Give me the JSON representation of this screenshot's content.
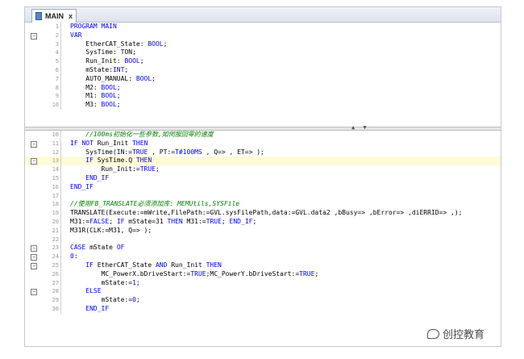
{
  "tab": {
    "title": "MAIN",
    "close": "x"
  },
  "top_pane": {
    "lines": [
      {
        "n": "1",
        "fold": "",
        "segs": [
          [
            "kw",
            "PROGRAM MAIN"
          ]
        ]
      },
      {
        "n": "2",
        "fold": "−",
        "segs": [
          [
            "kw",
            "VAR"
          ]
        ]
      },
      {
        "n": "3",
        "fold": "",
        "segs": [
          [
            "",
            "    EtherCAT_State: "
          ],
          [
            "kw",
            "BOOL"
          ],
          [
            "",
            ";"
          ]
        ]
      },
      {
        "n": "4",
        "fold": "",
        "segs": [
          [
            "",
            "    SysTime: TON;"
          ]
        ]
      },
      {
        "n": "5",
        "fold": "",
        "segs": [
          [
            "",
            "    Run_Init: "
          ],
          [
            "kw",
            "BOOL"
          ],
          [
            "",
            ";"
          ]
        ]
      },
      {
        "n": "6",
        "fold": "",
        "segs": [
          [
            "",
            "    mState:"
          ],
          [
            "kw",
            "INT"
          ],
          [
            "",
            ";"
          ]
        ]
      },
      {
        "n": "7",
        "fold": "",
        "segs": [
          [
            "",
            "    AUTO_MANUAL: "
          ],
          [
            "kw",
            "BOOL"
          ],
          [
            "",
            ";"
          ]
        ]
      },
      {
        "n": "8",
        "fold": "",
        "segs": [
          [
            "",
            "    M2: "
          ],
          [
            "kw",
            "BOOL"
          ],
          [
            "",
            ";"
          ]
        ]
      },
      {
        "n": "9",
        "fold": "",
        "segs": [
          [
            "",
            "    M1: "
          ],
          [
            "kw",
            "BOOL"
          ],
          [
            "",
            ";"
          ]
        ]
      },
      {
        "n": "10",
        "fold": "",
        "segs": [
          [
            "",
            "    M3: "
          ],
          [
            "kw",
            "BOOL"
          ],
          [
            "",
            ";"
          ]
        ]
      }
    ]
  },
  "bottom_pane": {
    "lines": [
      {
        "n": "10",
        "fold": "",
        "hl": false,
        "segs": [
          [
            "cm",
            "    //100ms初始化一些参数,如伺服回零的速度"
          ]
        ]
      },
      {
        "n": "11",
        "fold": "−",
        "hl": false,
        "segs": [
          [
            "kw",
            "IF NOT "
          ],
          [
            "",
            "Run_Init "
          ],
          [
            "kw",
            "THEN"
          ]
        ]
      },
      {
        "n": "12",
        "fold": "",
        "hl": false,
        "segs": [
          [
            "",
            "    SysTime(IN:="
          ],
          [
            "kw",
            "TRUE"
          ],
          [
            "",
            " , PT:="
          ],
          [
            "kw",
            "T#100MS"
          ],
          [
            "",
            " , Q=> , ET=> );"
          ]
        ]
      },
      {
        "n": "13",
        "fold": "−",
        "hl": true,
        "segs": [
          [
            "kw",
            "    IF "
          ],
          [
            "",
            "SysTime.Q "
          ],
          [
            "kw",
            "THEN"
          ]
        ]
      },
      {
        "n": "14",
        "fold": "",
        "hl": false,
        "segs": [
          [
            "",
            "        Run_Init:="
          ],
          [
            "kw",
            "TRUE"
          ],
          [
            "",
            ";"
          ]
        ]
      },
      {
        "n": "15",
        "fold": "",
        "hl": false,
        "segs": [
          [
            "kw",
            "    END_IF"
          ]
        ]
      },
      {
        "n": "16",
        "fold": "",
        "hl": false,
        "segs": [
          [
            "kw",
            "END_IF"
          ]
        ]
      },
      {
        "n": "17",
        "fold": "",
        "hl": false,
        "segs": [
          [
            "",
            ""
          ]
        ]
      },
      {
        "n": "18",
        "fold": "",
        "hl": false,
        "segs": [
          [
            "cm",
            "//使用FB_TRANSLATE必须添加库: MEMUtils,SYSFile"
          ]
        ]
      },
      {
        "n": "19",
        "fold": "",
        "hl": false,
        "segs": [
          [
            "",
            "TRANSLATE(Execute:=mWrite,FilePath:=GVL.sysFilePath,data:=GVL.data2 ,bBusy=> ,bError=> ,diERRID=> ,);"
          ]
        ]
      },
      {
        "n": "20",
        "fold": "",
        "hl": false,
        "segs": [
          [
            "",
            "M31:="
          ],
          [
            "kw",
            "FALSE"
          ],
          [
            "",
            "; "
          ],
          [
            "kw",
            "IF "
          ],
          [
            "",
            "mState=31 "
          ],
          [
            "kw",
            "THEN "
          ],
          [
            "",
            "M31:="
          ],
          [
            "kw",
            "TRUE"
          ],
          [
            "",
            "; "
          ],
          [
            "kw",
            "END_IF"
          ],
          [
            "",
            ";"
          ]
        ]
      },
      {
        "n": "21",
        "fold": "",
        "hl": false,
        "segs": [
          [
            "",
            "M31R(CLK:=M31, Q=> );"
          ]
        ]
      },
      {
        "n": "22",
        "fold": "",
        "hl": false,
        "segs": [
          [
            "",
            ""
          ]
        ]
      },
      {
        "n": "23",
        "fold": "−",
        "hl": false,
        "segs": [
          [
            "kw",
            "CASE "
          ],
          [
            "",
            "mState "
          ],
          [
            "kw",
            "OF"
          ]
        ]
      },
      {
        "n": "24",
        "fold": "−",
        "hl": false,
        "segs": [
          [
            "kw",
            "0"
          ],
          [
            "",
            ":"
          ]
        ]
      },
      {
        "n": "25",
        "fold": "−",
        "hl": false,
        "segs": [
          [
            "kw",
            "    IF "
          ],
          [
            "",
            "EtherCAT_State "
          ],
          [
            "kw",
            "AND "
          ],
          [
            "",
            "Run_Init "
          ],
          [
            "kw",
            "THEN"
          ]
        ]
      },
      {
        "n": "26",
        "fold": "",
        "hl": false,
        "segs": [
          [
            "",
            "        MC_PowerX.bDriveStart:="
          ],
          [
            "kw",
            "TRUE"
          ],
          [
            "",
            ";MC_PowerY.bDriveStart:="
          ],
          [
            "kw",
            "TRUE"
          ],
          [
            "",
            ";"
          ]
        ]
      },
      {
        "n": "27",
        "fold": "",
        "hl": false,
        "segs": [
          [
            "",
            "        mState:="
          ],
          [
            "kw",
            "1"
          ],
          [
            "",
            ";"
          ]
        ]
      },
      {
        "n": "28",
        "fold": "−",
        "hl": false,
        "segs": [
          [
            "kw",
            "    ELSE"
          ]
        ]
      },
      {
        "n": "29",
        "fold": "",
        "hl": false,
        "segs": [
          [
            "",
            "        mState:="
          ],
          [
            "kw",
            "0"
          ],
          [
            "",
            ";"
          ]
        ]
      },
      {
        "n": "30",
        "fold": "",
        "hl": false,
        "segs": [
          [
            "kw",
            "    END_IF"
          ]
        ]
      }
    ]
  },
  "watermark": {
    "text": "创控教育"
  },
  "colors": {
    "keyword": "#0000ff",
    "comment": "#008000",
    "highlight": "#fffbd6"
  }
}
